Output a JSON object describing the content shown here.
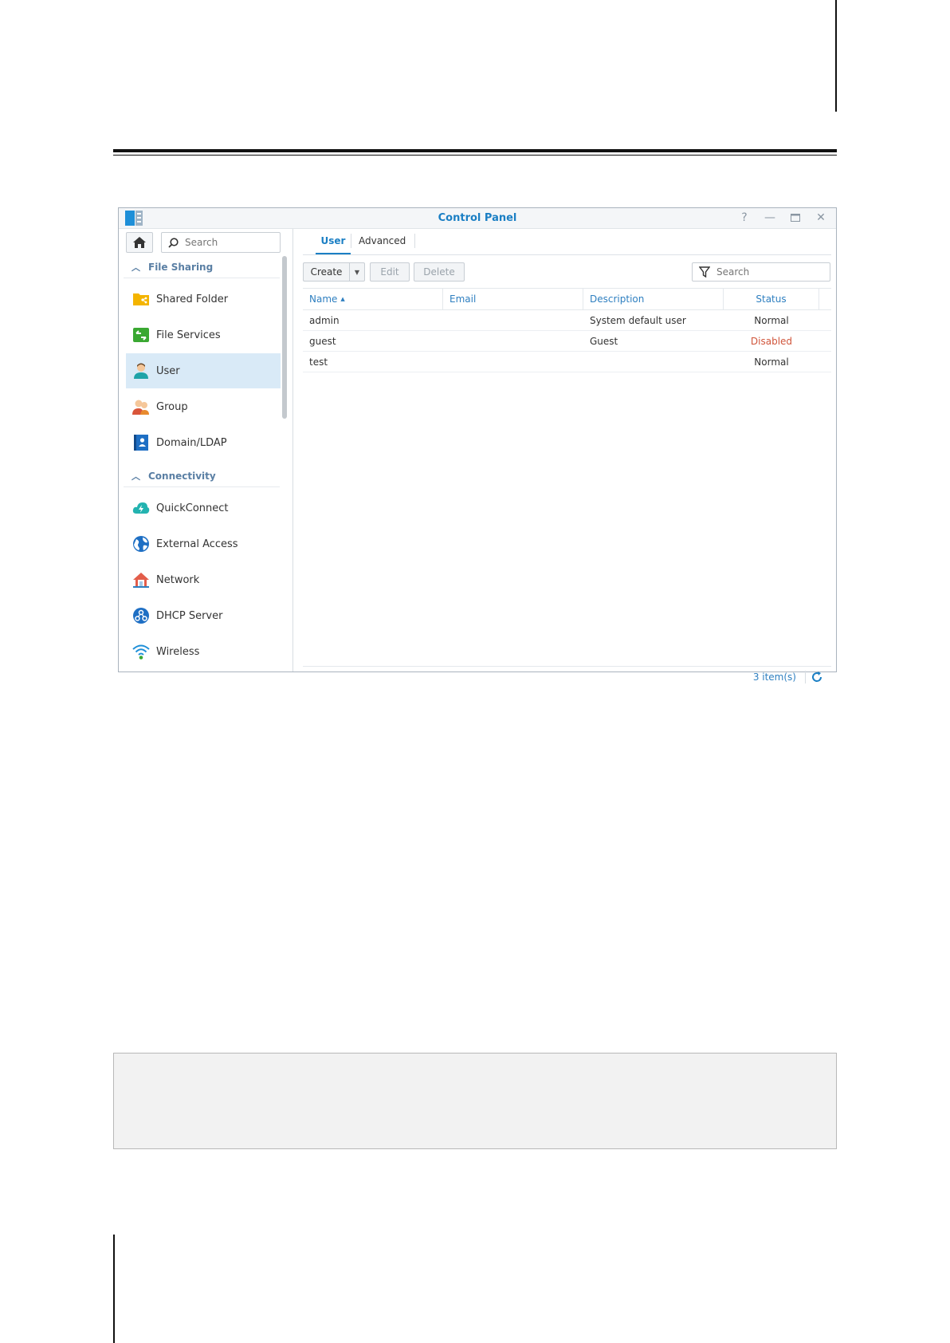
{
  "window": {
    "title": "Control Panel",
    "controls": [
      "help-icon",
      "minimize-icon",
      "maximize-icon",
      "close-icon"
    ]
  },
  "sidebar": {
    "search_placeholder": "Search",
    "sections": [
      {
        "label": "File Sharing",
        "items": [
          {
            "label": "Shared Folder",
            "icon": "shared-folder-icon"
          },
          {
            "label": "File Services",
            "icon": "file-services-icon"
          },
          {
            "label": "User",
            "icon": "user-icon",
            "active": true
          },
          {
            "label": "Group",
            "icon": "group-icon"
          },
          {
            "label": "Domain/LDAP",
            "icon": "domain-ldap-icon"
          }
        ]
      },
      {
        "label": "Connectivity",
        "items": [
          {
            "label": "QuickConnect",
            "icon": "quickconnect-icon"
          },
          {
            "label": "External Access",
            "icon": "external-access-icon"
          },
          {
            "label": "Network",
            "icon": "network-icon"
          },
          {
            "label": "DHCP Server",
            "icon": "dhcp-server-icon"
          },
          {
            "label": "Wireless",
            "icon": "wireless-icon"
          }
        ]
      }
    ]
  },
  "main": {
    "tabs": [
      {
        "label": "User",
        "active": true
      },
      {
        "label": "Advanced",
        "active": false
      }
    ],
    "toolbar": {
      "create_label": "Create",
      "edit_label": "Edit",
      "delete_label": "Delete",
      "search_placeholder": "Search"
    },
    "table": {
      "columns": [
        "Name",
        "Email",
        "Description",
        "Status"
      ],
      "sort_column": "Name",
      "rows": [
        {
          "name": "admin",
          "email": "",
          "description": "System default user",
          "status": "Normal"
        },
        {
          "name": "guest",
          "email": "",
          "description": "Guest",
          "status": "Disabled"
        },
        {
          "name": "test",
          "email": "",
          "description": "",
          "status": "Normal"
        }
      ]
    },
    "footer": {
      "item_count": "3 item(s)"
    }
  },
  "colors": {
    "accent": "#1b7fc4",
    "disabled_status": "#d0553b",
    "active_nav_bg": "#d9eaf7"
  }
}
